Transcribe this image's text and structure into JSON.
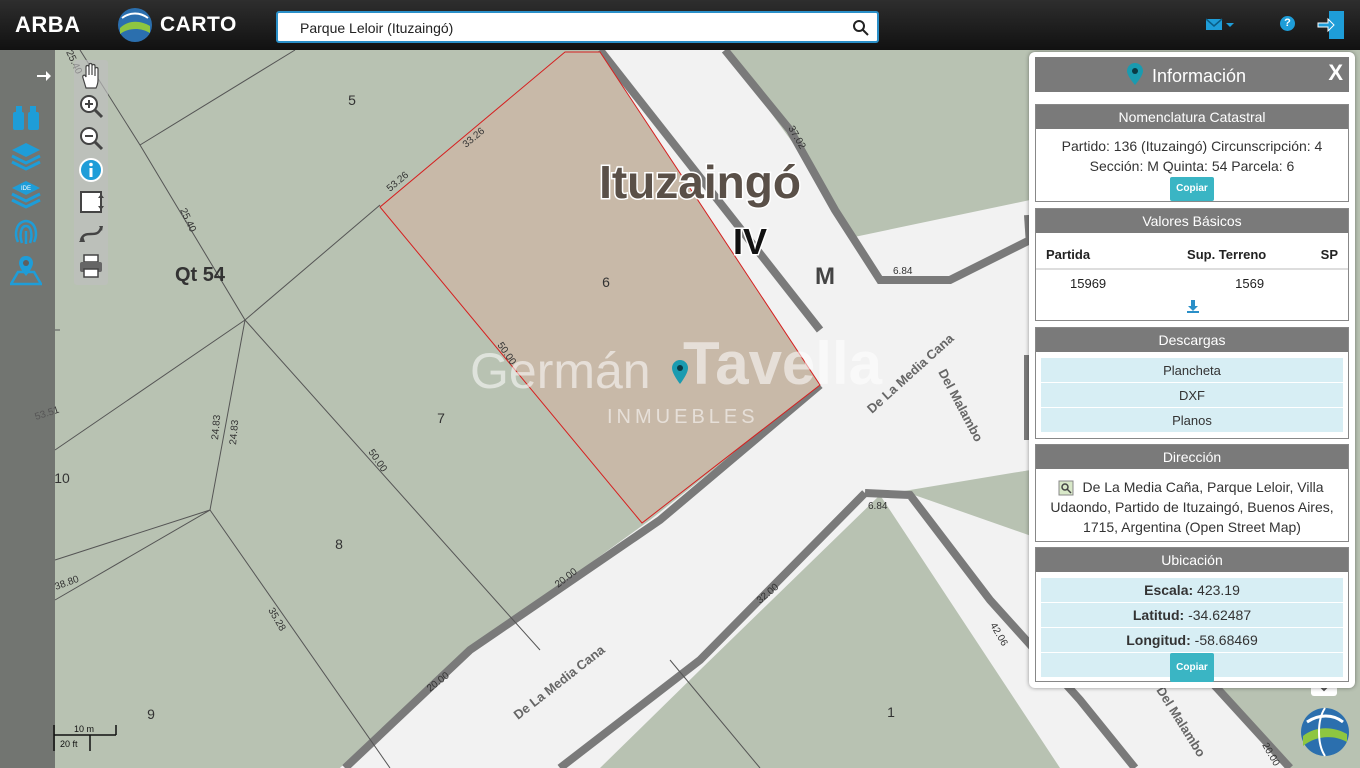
{
  "header": {
    "brand": "ARBA",
    "app_name": "CARTO",
    "search_value": "Parque Leloir (Ituzaingó)"
  },
  "map": {
    "locality": "Ituzaingó",
    "circunscripcion_label": "IV",
    "section_label": "M",
    "quinta_label": "Qt 54",
    "watermark_main_1": "Germán",
    "watermark_main_2": "Tavella",
    "watermark_sub": "INMUEBLES",
    "parcel_numbers": [
      "5",
      "6",
      "7",
      "8",
      "9",
      "10",
      "1"
    ],
    "dimensions": [
      "25.40",
      "25.40",
      "33.26",
      "53.26",
      "50.00",
      "50.00",
      "24.83",
      "24.83",
      "20.00",
      "20.00",
      "38.80",
      "35.28",
      "53.51",
      "37.02",
      "6.84",
      "6.84",
      "32.00",
      "42.06",
      "20.00"
    ],
    "streets": [
      "De La Media Cana",
      "Del Malambo",
      "De La Media Cana",
      "Del Malambo"
    ],
    "scale_m": "10 m",
    "scale_ft": "20 ft"
  },
  "info": {
    "title": "Información",
    "close": "X",
    "nomenclatura": {
      "heading": "Nomenclatura Catastral",
      "line1": "Partido: 136 (Ituzaingó) Circunscripción: 4",
      "line2": "Sección: M Quinta: 54 Parcela: 6",
      "copy_label": "Copiar"
    },
    "valores": {
      "heading": "Valores Básicos",
      "columns": [
        "Partida",
        "Sup. Terreno",
        "SP"
      ],
      "row": [
        "15969",
        "1569",
        ""
      ]
    },
    "descargas": {
      "heading": "Descargas",
      "items": [
        "Plancheta",
        "DXF",
        "Planos"
      ]
    },
    "direccion": {
      "heading": "Dirección",
      "text": "De La Media Caña, Parque Leloir, Villa Udaondo, Partido de Ituzaingó, Buenos Aires, 1715, Argentina (Open Street Map)"
    },
    "ubicacion": {
      "heading": "Ubicación",
      "escala_label": "Escala:",
      "escala_value": "423.19",
      "latitud_label": "Latitud:",
      "latitud_value": "-34.62487",
      "longitud_label": "Longitud:",
      "longitud_value": "-58.68469",
      "copy_label": "Copiar"
    }
  },
  "colors": {
    "accent": "#2a8fc8",
    "parcel_fill": "#c8b9a8",
    "parcel_border": "#d62020",
    "map_bg": "#b8c2b2",
    "road": "#f2f2f2",
    "copy_button": "#3ab5c4"
  }
}
